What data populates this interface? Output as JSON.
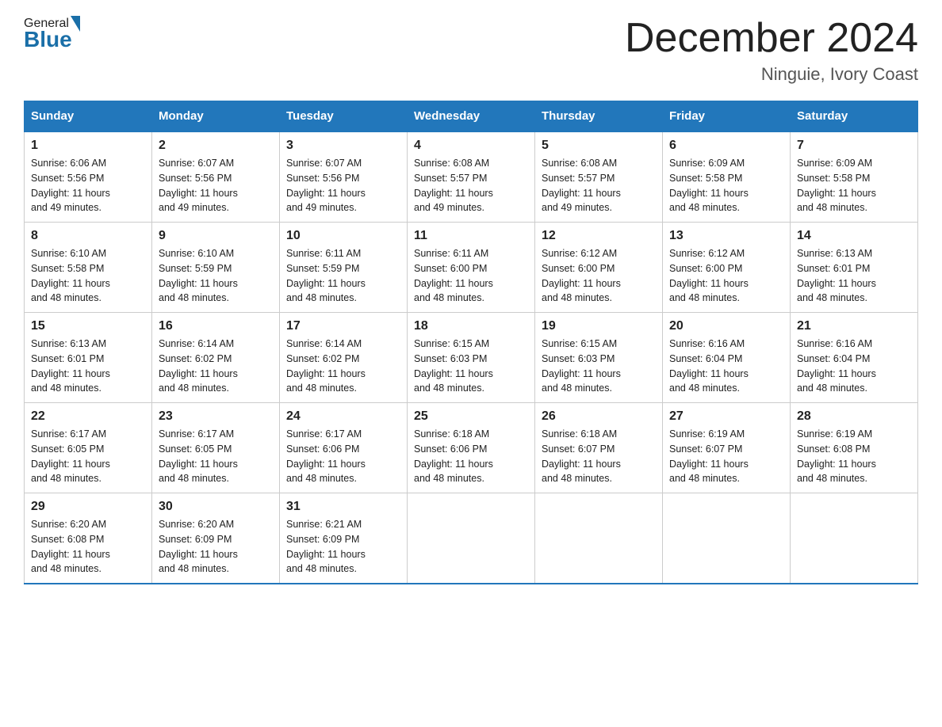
{
  "header": {
    "title": "December 2024",
    "location": "Ninguie, Ivory Coast",
    "logo_general": "General",
    "logo_blue": "Blue"
  },
  "days_of_week": [
    "Sunday",
    "Monday",
    "Tuesday",
    "Wednesday",
    "Thursday",
    "Friday",
    "Saturday"
  ],
  "weeks": [
    [
      {
        "day": "1",
        "sunrise": "6:06 AM",
        "sunset": "5:56 PM",
        "daylight": "11 hours and 49 minutes."
      },
      {
        "day": "2",
        "sunrise": "6:07 AM",
        "sunset": "5:56 PM",
        "daylight": "11 hours and 49 minutes."
      },
      {
        "day": "3",
        "sunrise": "6:07 AM",
        "sunset": "5:56 PM",
        "daylight": "11 hours and 49 minutes."
      },
      {
        "day": "4",
        "sunrise": "6:08 AM",
        "sunset": "5:57 PM",
        "daylight": "11 hours and 49 minutes."
      },
      {
        "day": "5",
        "sunrise": "6:08 AM",
        "sunset": "5:57 PM",
        "daylight": "11 hours and 49 minutes."
      },
      {
        "day": "6",
        "sunrise": "6:09 AM",
        "sunset": "5:58 PM",
        "daylight": "11 hours and 48 minutes."
      },
      {
        "day": "7",
        "sunrise": "6:09 AM",
        "sunset": "5:58 PM",
        "daylight": "11 hours and 48 minutes."
      }
    ],
    [
      {
        "day": "8",
        "sunrise": "6:10 AM",
        "sunset": "5:58 PM",
        "daylight": "11 hours and 48 minutes."
      },
      {
        "day": "9",
        "sunrise": "6:10 AM",
        "sunset": "5:59 PM",
        "daylight": "11 hours and 48 minutes."
      },
      {
        "day": "10",
        "sunrise": "6:11 AM",
        "sunset": "5:59 PM",
        "daylight": "11 hours and 48 minutes."
      },
      {
        "day": "11",
        "sunrise": "6:11 AM",
        "sunset": "6:00 PM",
        "daylight": "11 hours and 48 minutes."
      },
      {
        "day": "12",
        "sunrise": "6:12 AM",
        "sunset": "6:00 PM",
        "daylight": "11 hours and 48 minutes."
      },
      {
        "day": "13",
        "sunrise": "6:12 AM",
        "sunset": "6:00 PM",
        "daylight": "11 hours and 48 minutes."
      },
      {
        "day": "14",
        "sunrise": "6:13 AM",
        "sunset": "6:01 PM",
        "daylight": "11 hours and 48 minutes."
      }
    ],
    [
      {
        "day": "15",
        "sunrise": "6:13 AM",
        "sunset": "6:01 PM",
        "daylight": "11 hours and 48 minutes."
      },
      {
        "day": "16",
        "sunrise": "6:14 AM",
        "sunset": "6:02 PM",
        "daylight": "11 hours and 48 minutes."
      },
      {
        "day": "17",
        "sunrise": "6:14 AM",
        "sunset": "6:02 PM",
        "daylight": "11 hours and 48 minutes."
      },
      {
        "day": "18",
        "sunrise": "6:15 AM",
        "sunset": "6:03 PM",
        "daylight": "11 hours and 48 minutes."
      },
      {
        "day": "19",
        "sunrise": "6:15 AM",
        "sunset": "6:03 PM",
        "daylight": "11 hours and 48 minutes."
      },
      {
        "day": "20",
        "sunrise": "6:16 AM",
        "sunset": "6:04 PM",
        "daylight": "11 hours and 48 minutes."
      },
      {
        "day": "21",
        "sunrise": "6:16 AM",
        "sunset": "6:04 PM",
        "daylight": "11 hours and 48 minutes."
      }
    ],
    [
      {
        "day": "22",
        "sunrise": "6:17 AM",
        "sunset": "6:05 PM",
        "daylight": "11 hours and 48 minutes."
      },
      {
        "day": "23",
        "sunrise": "6:17 AM",
        "sunset": "6:05 PM",
        "daylight": "11 hours and 48 minutes."
      },
      {
        "day": "24",
        "sunrise": "6:17 AM",
        "sunset": "6:06 PM",
        "daylight": "11 hours and 48 minutes."
      },
      {
        "day": "25",
        "sunrise": "6:18 AM",
        "sunset": "6:06 PM",
        "daylight": "11 hours and 48 minutes."
      },
      {
        "day": "26",
        "sunrise": "6:18 AM",
        "sunset": "6:07 PM",
        "daylight": "11 hours and 48 minutes."
      },
      {
        "day": "27",
        "sunrise": "6:19 AM",
        "sunset": "6:07 PM",
        "daylight": "11 hours and 48 minutes."
      },
      {
        "day": "28",
        "sunrise": "6:19 AM",
        "sunset": "6:08 PM",
        "daylight": "11 hours and 48 minutes."
      }
    ],
    [
      {
        "day": "29",
        "sunrise": "6:20 AM",
        "sunset": "6:08 PM",
        "daylight": "11 hours and 48 minutes."
      },
      {
        "day": "30",
        "sunrise": "6:20 AM",
        "sunset": "6:09 PM",
        "daylight": "11 hours and 48 minutes."
      },
      {
        "day": "31",
        "sunrise": "6:21 AM",
        "sunset": "6:09 PM",
        "daylight": "11 hours and 48 minutes."
      },
      null,
      null,
      null,
      null
    ]
  ],
  "labels": {
    "sunrise": "Sunrise:",
    "sunset": "Sunset:",
    "daylight": "Daylight: 11 hours"
  }
}
